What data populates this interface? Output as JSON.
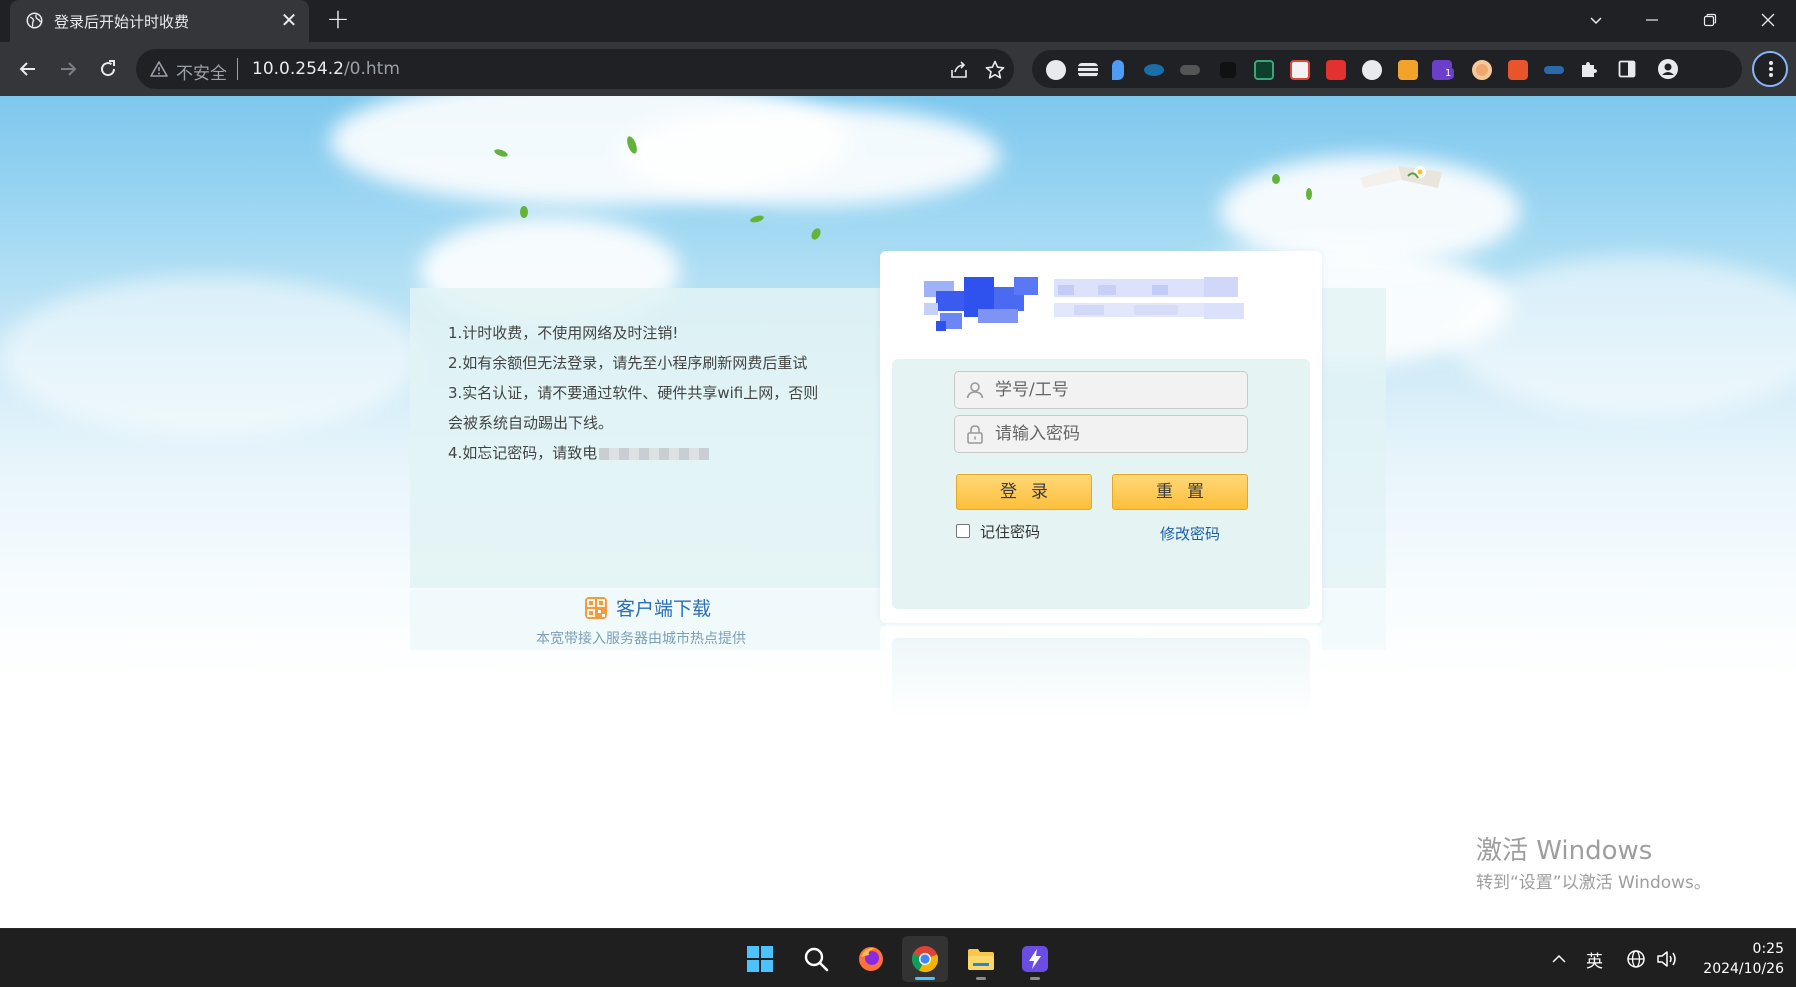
{
  "browser": {
    "tab_title": "登录后开始计时收费",
    "security_label": "不安全",
    "url_host": "10.0.254.2",
    "url_path": "/0.htm",
    "extension_badge": "1"
  },
  "notice": {
    "lines": [
      "1.计时收费，不使用网络及时注销!",
      "2.如有余额但无法登录，请先至小程序刷新网费后重试",
      "3.实名认证，请不要通过软件、硬件共享wifi上网，否则",
      "会被系统自动踢出下线。",
      "4.如忘记密码，请致电"
    ]
  },
  "client": {
    "download_label": "客户端下载",
    "provider_text": "本宽带接入服务器由城市热点提供"
  },
  "login": {
    "username_placeholder": "学号/工号",
    "password_placeholder": "请输入密码",
    "login_button": "登录",
    "reset_button": "重置",
    "remember_label": "记住密码",
    "change_password_link": "修改密码"
  },
  "watermark": {
    "title": "激活 Windows",
    "subtitle": "转到“设置”以激活 Windows。"
  },
  "taskbar": {
    "ime_label": "英",
    "time": "0:25",
    "date": "2024/10/26"
  }
}
